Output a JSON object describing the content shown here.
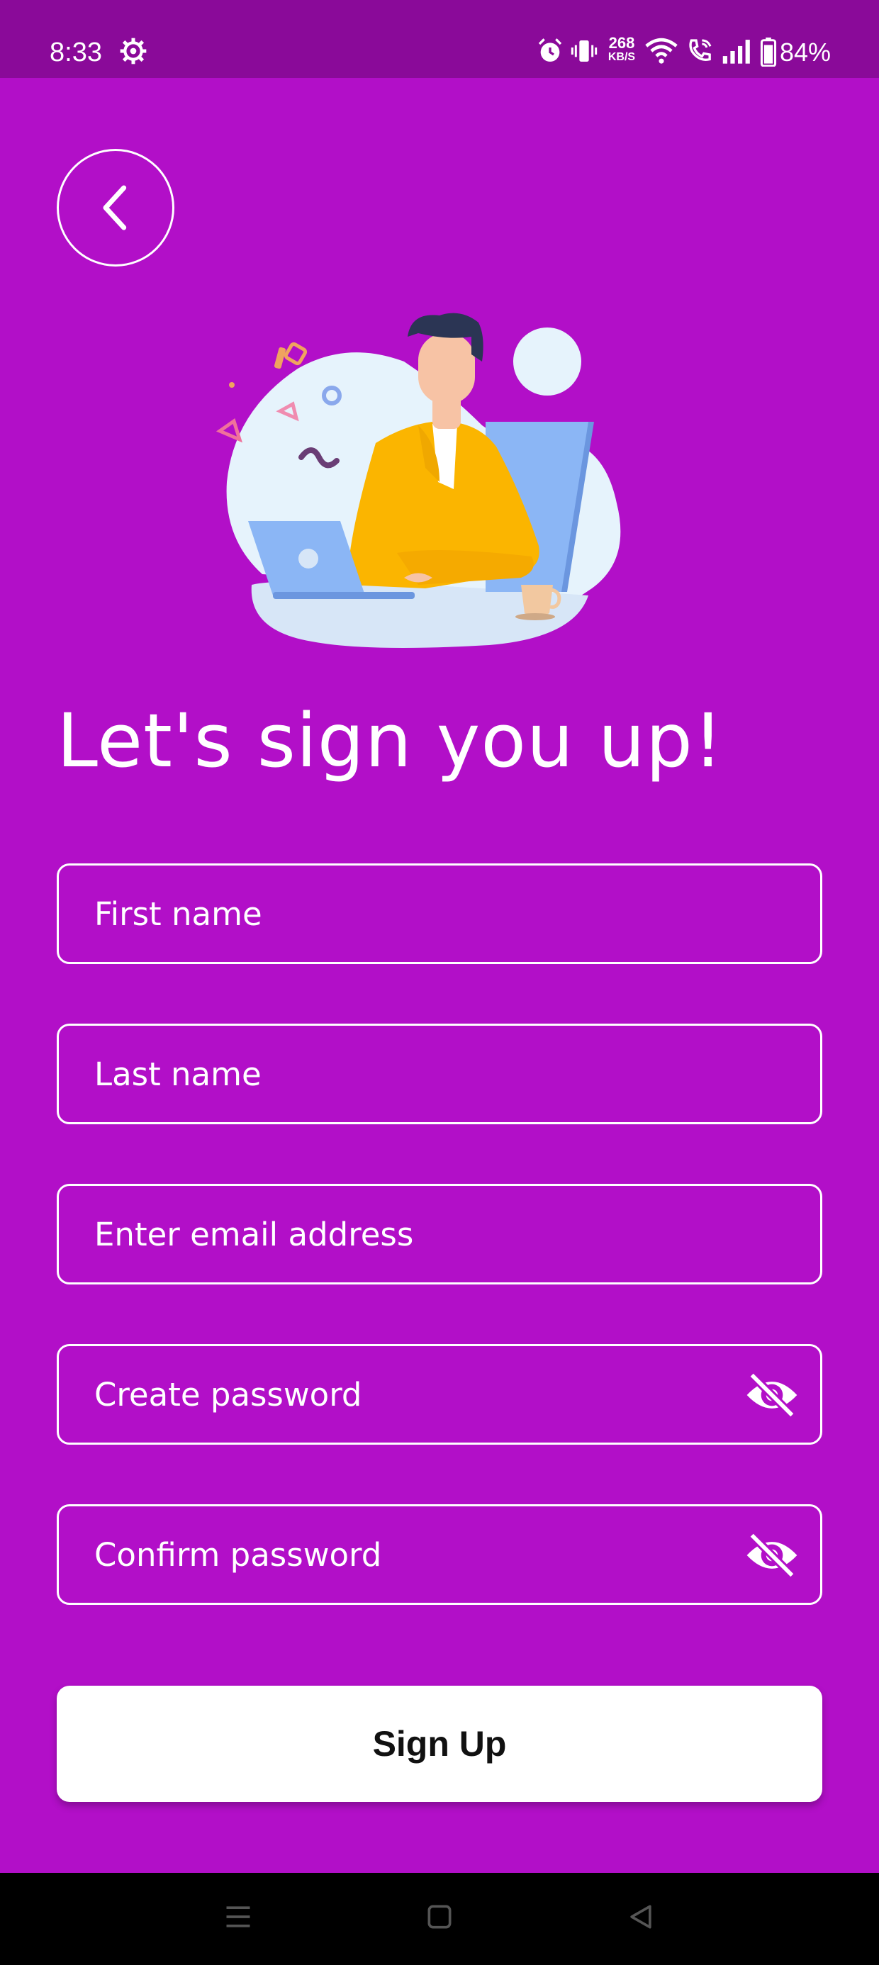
{
  "status_bar": {
    "time": "8:33",
    "network_speed_value": "268",
    "network_speed_unit": "KB/S",
    "battery": "84%",
    "icons": [
      "settings-gear-icon",
      "alarm-icon",
      "vibrate-icon",
      "wifi-icon",
      "wifi-calling-icon",
      "signal-icon",
      "battery-icon"
    ]
  },
  "header": {
    "back_icon": "chevron-left-icon"
  },
  "main": {
    "heading": "Let's sign you up!",
    "fields": {
      "first_name": {
        "placeholder": "First name",
        "value": ""
      },
      "last_name": {
        "placeholder": "Last name",
        "value": ""
      },
      "email": {
        "placeholder": "Enter email address",
        "value": ""
      },
      "password": {
        "placeholder": "Create password",
        "value": "",
        "toggle_icon": "eye-off-icon"
      },
      "confirm_password": {
        "placeholder": "Confirm password",
        "value": "",
        "toggle_icon": "eye-off-icon"
      }
    },
    "submit_label": "Sign Up"
  },
  "nav_bar": {
    "items": [
      "menu-icon",
      "home-icon",
      "back-triangle-icon"
    ]
  },
  "colors": {
    "background": "#b20fc8",
    "status_bar": "#8a0a99",
    "button": "#ffffff",
    "illustration_yellow": "#fbb500",
    "illustration_blue": "#8bb6f5"
  }
}
